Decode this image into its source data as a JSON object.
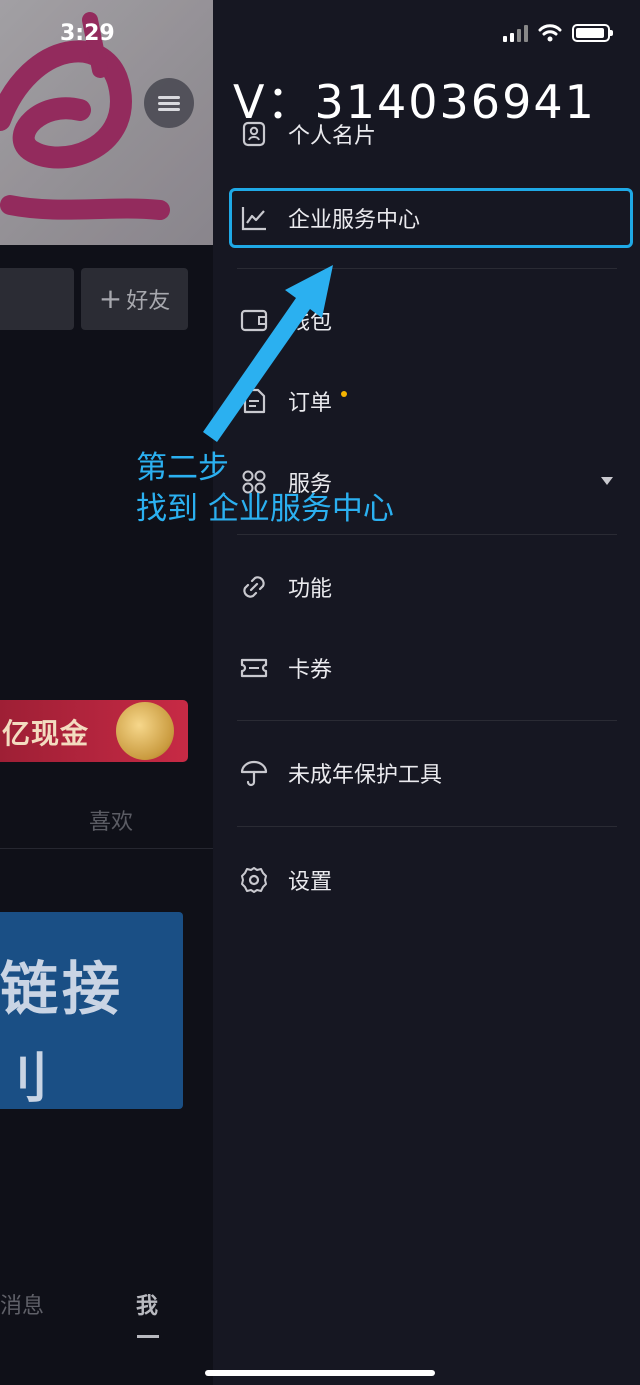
{
  "status": {
    "time": "3:29"
  },
  "left_page": {
    "add_friend_label": "好友",
    "promo_text": "亿现金",
    "tab_likes": "喜欢",
    "video_line1": "链接",
    "video_line2": "刂",
    "nav_messages": "消息",
    "nav_me": "我"
  },
  "drawer": {
    "user_id": "V：314036941",
    "items": [
      {
        "label": "个人名片",
        "icon": "id-card-icon"
      },
      {
        "label": "企业服务中心",
        "icon": "chart-line-icon"
      },
      {
        "label": "钱包",
        "icon": "wallet-icon"
      },
      {
        "label": "订单",
        "icon": "order-doc-icon"
      },
      {
        "label": "服务",
        "icon": "grid-icon"
      },
      {
        "label": "功能",
        "icon": "link-icon"
      },
      {
        "label": "卡券",
        "icon": "ticket-icon"
      },
      {
        "label": "未成年保护工具",
        "icon": "umbrella-icon"
      },
      {
        "label": "设置",
        "icon": "gear-icon"
      }
    ]
  },
  "annotation": {
    "line1": "第二步",
    "line2": "找到 企业服务中心",
    "color": "#2bb0f0"
  },
  "colors": {
    "highlight": "#1fa9e6",
    "badge_dot": "#f5b400",
    "drawer_bg": "#161722"
  }
}
